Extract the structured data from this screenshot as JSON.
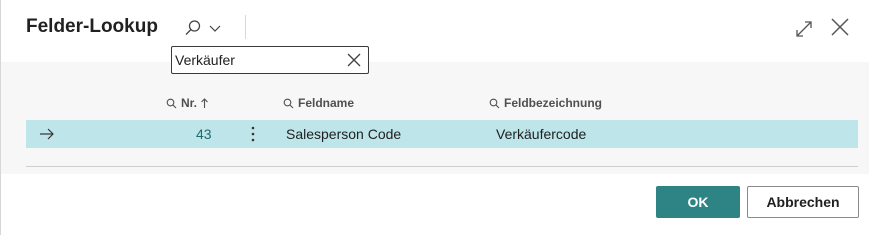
{
  "dialog": {
    "title": "Felder-Lookup"
  },
  "search": {
    "value": "Verkäufer"
  },
  "table": {
    "columns": [
      {
        "label": "Nr.",
        "sort": "ascending"
      },
      {
        "label": "Feldname"
      },
      {
        "label": "Feldbezeichnung"
      }
    ],
    "rows": [
      {
        "nr": "43",
        "feldname": "Salesperson Code",
        "feldbezeichnung": "Verkäufercode"
      }
    ]
  },
  "footer": {
    "ok_label": "OK",
    "cancel_label": "Abbrechen"
  },
  "colors": {
    "accent": "#2e8385",
    "selected_row": "#bee6ea",
    "body_background": "#f7f7f7"
  },
  "icons": [
    "search-icon",
    "chevron-down-icon",
    "expand-icon",
    "close-icon",
    "clear-icon",
    "arrow-right-icon",
    "more-vertical-icon",
    "sort-ascending-icon"
  ]
}
